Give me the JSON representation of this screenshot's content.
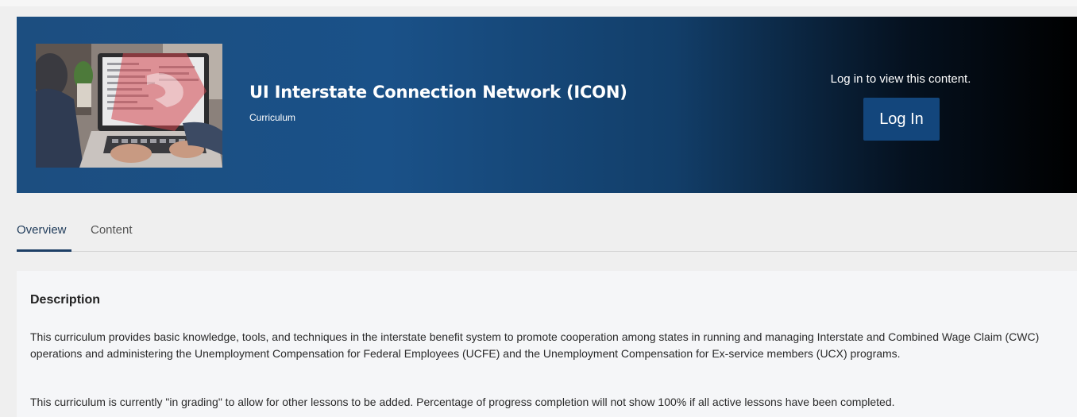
{
  "hero": {
    "title": "UI Interstate Connection Network (ICON)",
    "subtitle": "Curriculum",
    "login_prompt": "Log in to view this content.",
    "login_button_label": "Log In",
    "thumbnail_alt": "Person working at a laptop"
  },
  "tabs": [
    {
      "label": "Overview",
      "active": true
    },
    {
      "label": "Content",
      "active": false
    }
  ],
  "description": {
    "heading": "Description",
    "paragraphs": [
      "This curriculum provides basic knowledge, tools, and techniques in the interstate benefit system to promote cooperation among states in running and managing Interstate and Combined Wage Claim (CWC) operations and administering the Unemployment Compensation for Federal Employees (UCFE) and the Unemployment Compensation for Ex-service members (UCX) programs.",
      "This curriculum is currently \"in grading\" to allow for other lessons to be added. Percentage of progress completion will not show 100% if all active lessons have been completed."
    ]
  },
  "colors": {
    "hero_gradient_start": "#1c4e80",
    "hero_gradient_end": "#000000",
    "login_button_bg": "#13467c",
    "active_tab_underline": "#1d3f66",
    "page_background": "#efefef",
    "description_background": "#f5f6f8"
  }
}
